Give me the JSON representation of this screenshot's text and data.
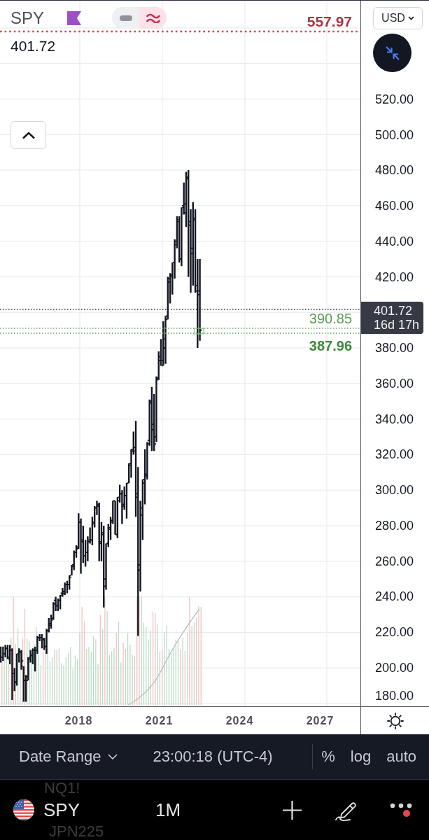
{
  "chart_header": {
    "symbol": "SPY",
    "last_price": "401.72",
    "view_toggle": [
      {
        "kind": "minus",
        "selected": false
      },
      {
        "kind": "wave",
        "selected": true
      }
    ],
    "high_price": "557.97"
  },
  "price_lines": [
    {
      "label": "390.85",
      "kind": "light"
    },
    {
      "label": "387.96",
      "kind": "strong"
    }
  ],
  "currency_dropdown": {
    "label": "USD"
  },
  "price_axis": {
    "labels_above": [
      "520.00",
      "500.00",
      "480.00",
      "460.00",
      "440.00",
      "420.00"
    ],
    "current_price_tag": {
      "price": "401.72",
      "countdown": "16d 17h"
    },
    "labels_below": [
      "380.00",
      "360.00",
      "340.00",
      "320.00",
      "300.00",
      "280.00",
      "260.00",
      "240.00",
      "220.00",
      "200.00",
      "180.00"
    ]
  },
  "time_axis": {
    "labels": [
      "2018",
      "2021",
      "2024",
      "2027"
    ]
  },
  "toolbar": {
    "date_range": "Date Range",
    "clock": "23:00:18 (UTC-4)",
    "scale_options": [
      "%",
      "log",
      "auto"
    ]
  },
  "bottom_bar": {
    "symbol": "SPY",
    "interval": "1M",
    "notification": true
  },
  "watchlist_behind": [
    "NQ1!",
    "JPN225"
  ]
}
